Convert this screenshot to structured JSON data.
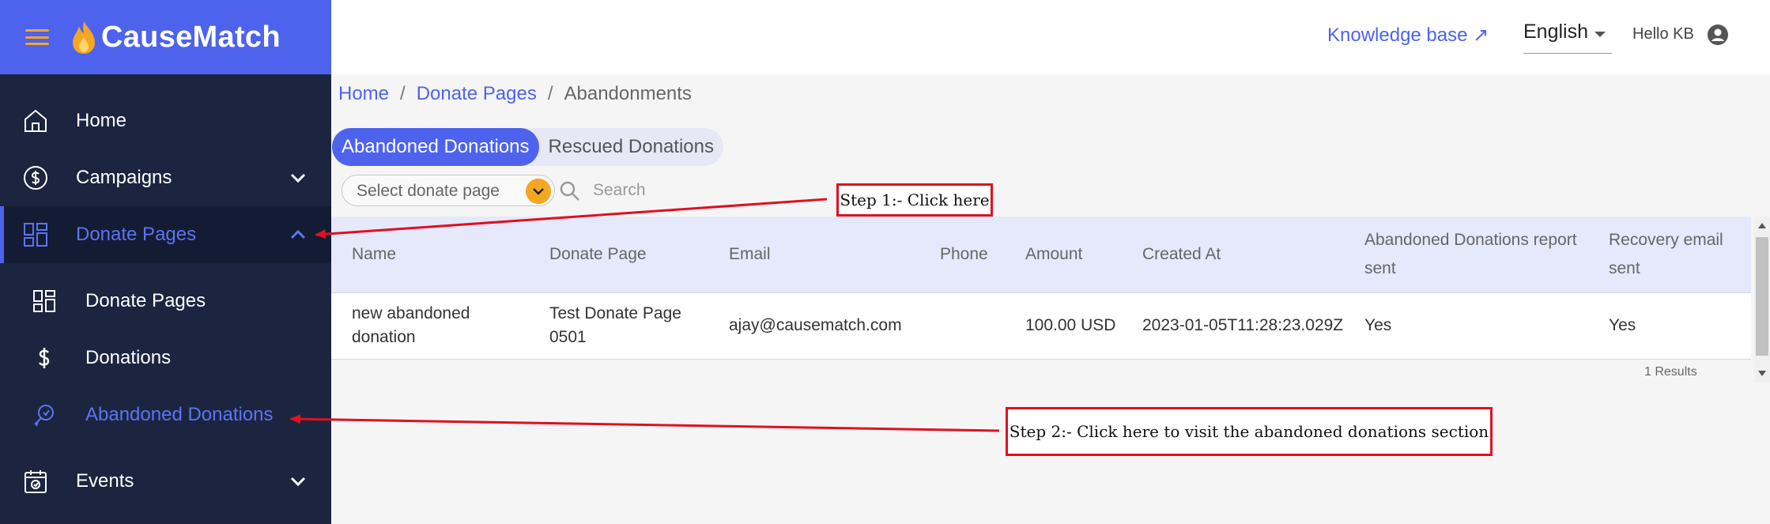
{
  "brand": {
    "name": "CauseMatch",
    "accent": "#4d63ee",
    "flame_color": "#f5a623"
  },
  "topbar": {
    "knowledge_base": "Knowledge base ↗",
    "language": "English",
    "greeting": "Hello KB"
  },
  "sidebar": {
    "items": [
      {
        "label": "Home",
        "icon": "home-icon"
      },
      {
        "label": "Campaigns",
        "icon": "dollar-circle-icon"
      },
      {
        "label": "Donate Pages",
        "icon": "grid-icon",
        "expanded": true
      },
      {
        "label": "Events",
        "icon": "calendar-icon"
      }
    ],
    "sub_items": [
      {
        "label": "Donate Pages",
        "icon": "grid-icon"
      },
      {
        "label": "Donations",
        "icon": "dollar-icon"
      },
      {
        "label": "Abandoned Donations",
        "icon": "rescue-icon"
      }
    ]
  },
  "breadcrumb": {
    "home": "Home",
    "donate_pages": "Donate Pages",
    "current": "Abandonments",
    "separator": "/"
  },
  "tabs": [
    {
      "label": "Abandoned Donations",
      "selected": true
    },
    {
      "label": "Rescued Donations",
      "selected": false
    }
  ],
  "filters": {
    "select_placeholder": "Select donate page",
    "search_placeholder": "Search"
  },
  "table": {
    "columns": [
      "Name",
      "Donate Page",
      "Email",
      "Phone",
      "Amount",
      "Created At",
      "Abandoned Donations report sent",
      "Recovery email sent"
    ],
    "rows": [
      {
        "name": "new abandoned donation",
        "donate_page": "Test Donate Page 0501",
        "email": "ajay@causematch.com",
        "phone": "",
        "amount": "100.00 USD",
        "created_at": "2023-01-05T11:28:23.029Z",
        "report_sent": "Yes",
        "recovery_sent": "Yes"
      }
    ],
    "results": "1 Results"
  },
  "annotations": {
    "step1": "Step 1:- Click here",
    "step2": "Step 2:- Click here to visit the abandoned donations section",
    "color": "#e01020"
  }
}
